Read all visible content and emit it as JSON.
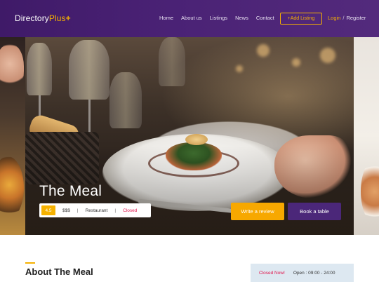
{
  "logo": {
    "part1": "Directory",
    "part2": "Plus",
    "plus": "+"
  },
  "nav": {
    "items": [
      "Home",
      "About us",
      "Listings",
      "News",
      "Contact"
    ],
    "add_listing": "+Add Listing",
    "login": "Login",
    "separator": "/",
    "register": "Register"
  },
  "hero": {
    "title": "The Meal",
    "rating": "4.5",
    "price": "$$$",
    "divider": "|",
    "category": "Restaurant",
    "status": "Closed",
    "review_button": "Write a review",
    "book_button": "Book a table"
  },
  "about": {
    "title": "About The Meal",
    "status_now": "Closed Now!",
    "open_hours": "Open : 09:00 - 24:00"
  },
  "colors": {
    "header": "#4a2275",
    "accent": "#f5b100",
    "closed": "#e0144b",
    "book_button": "#4b2779",
    "review_button": "#f7a800",
    "hours_bg": "#dde8f1"
  },
  "icons": [
    "food-photo"
  ]
}
